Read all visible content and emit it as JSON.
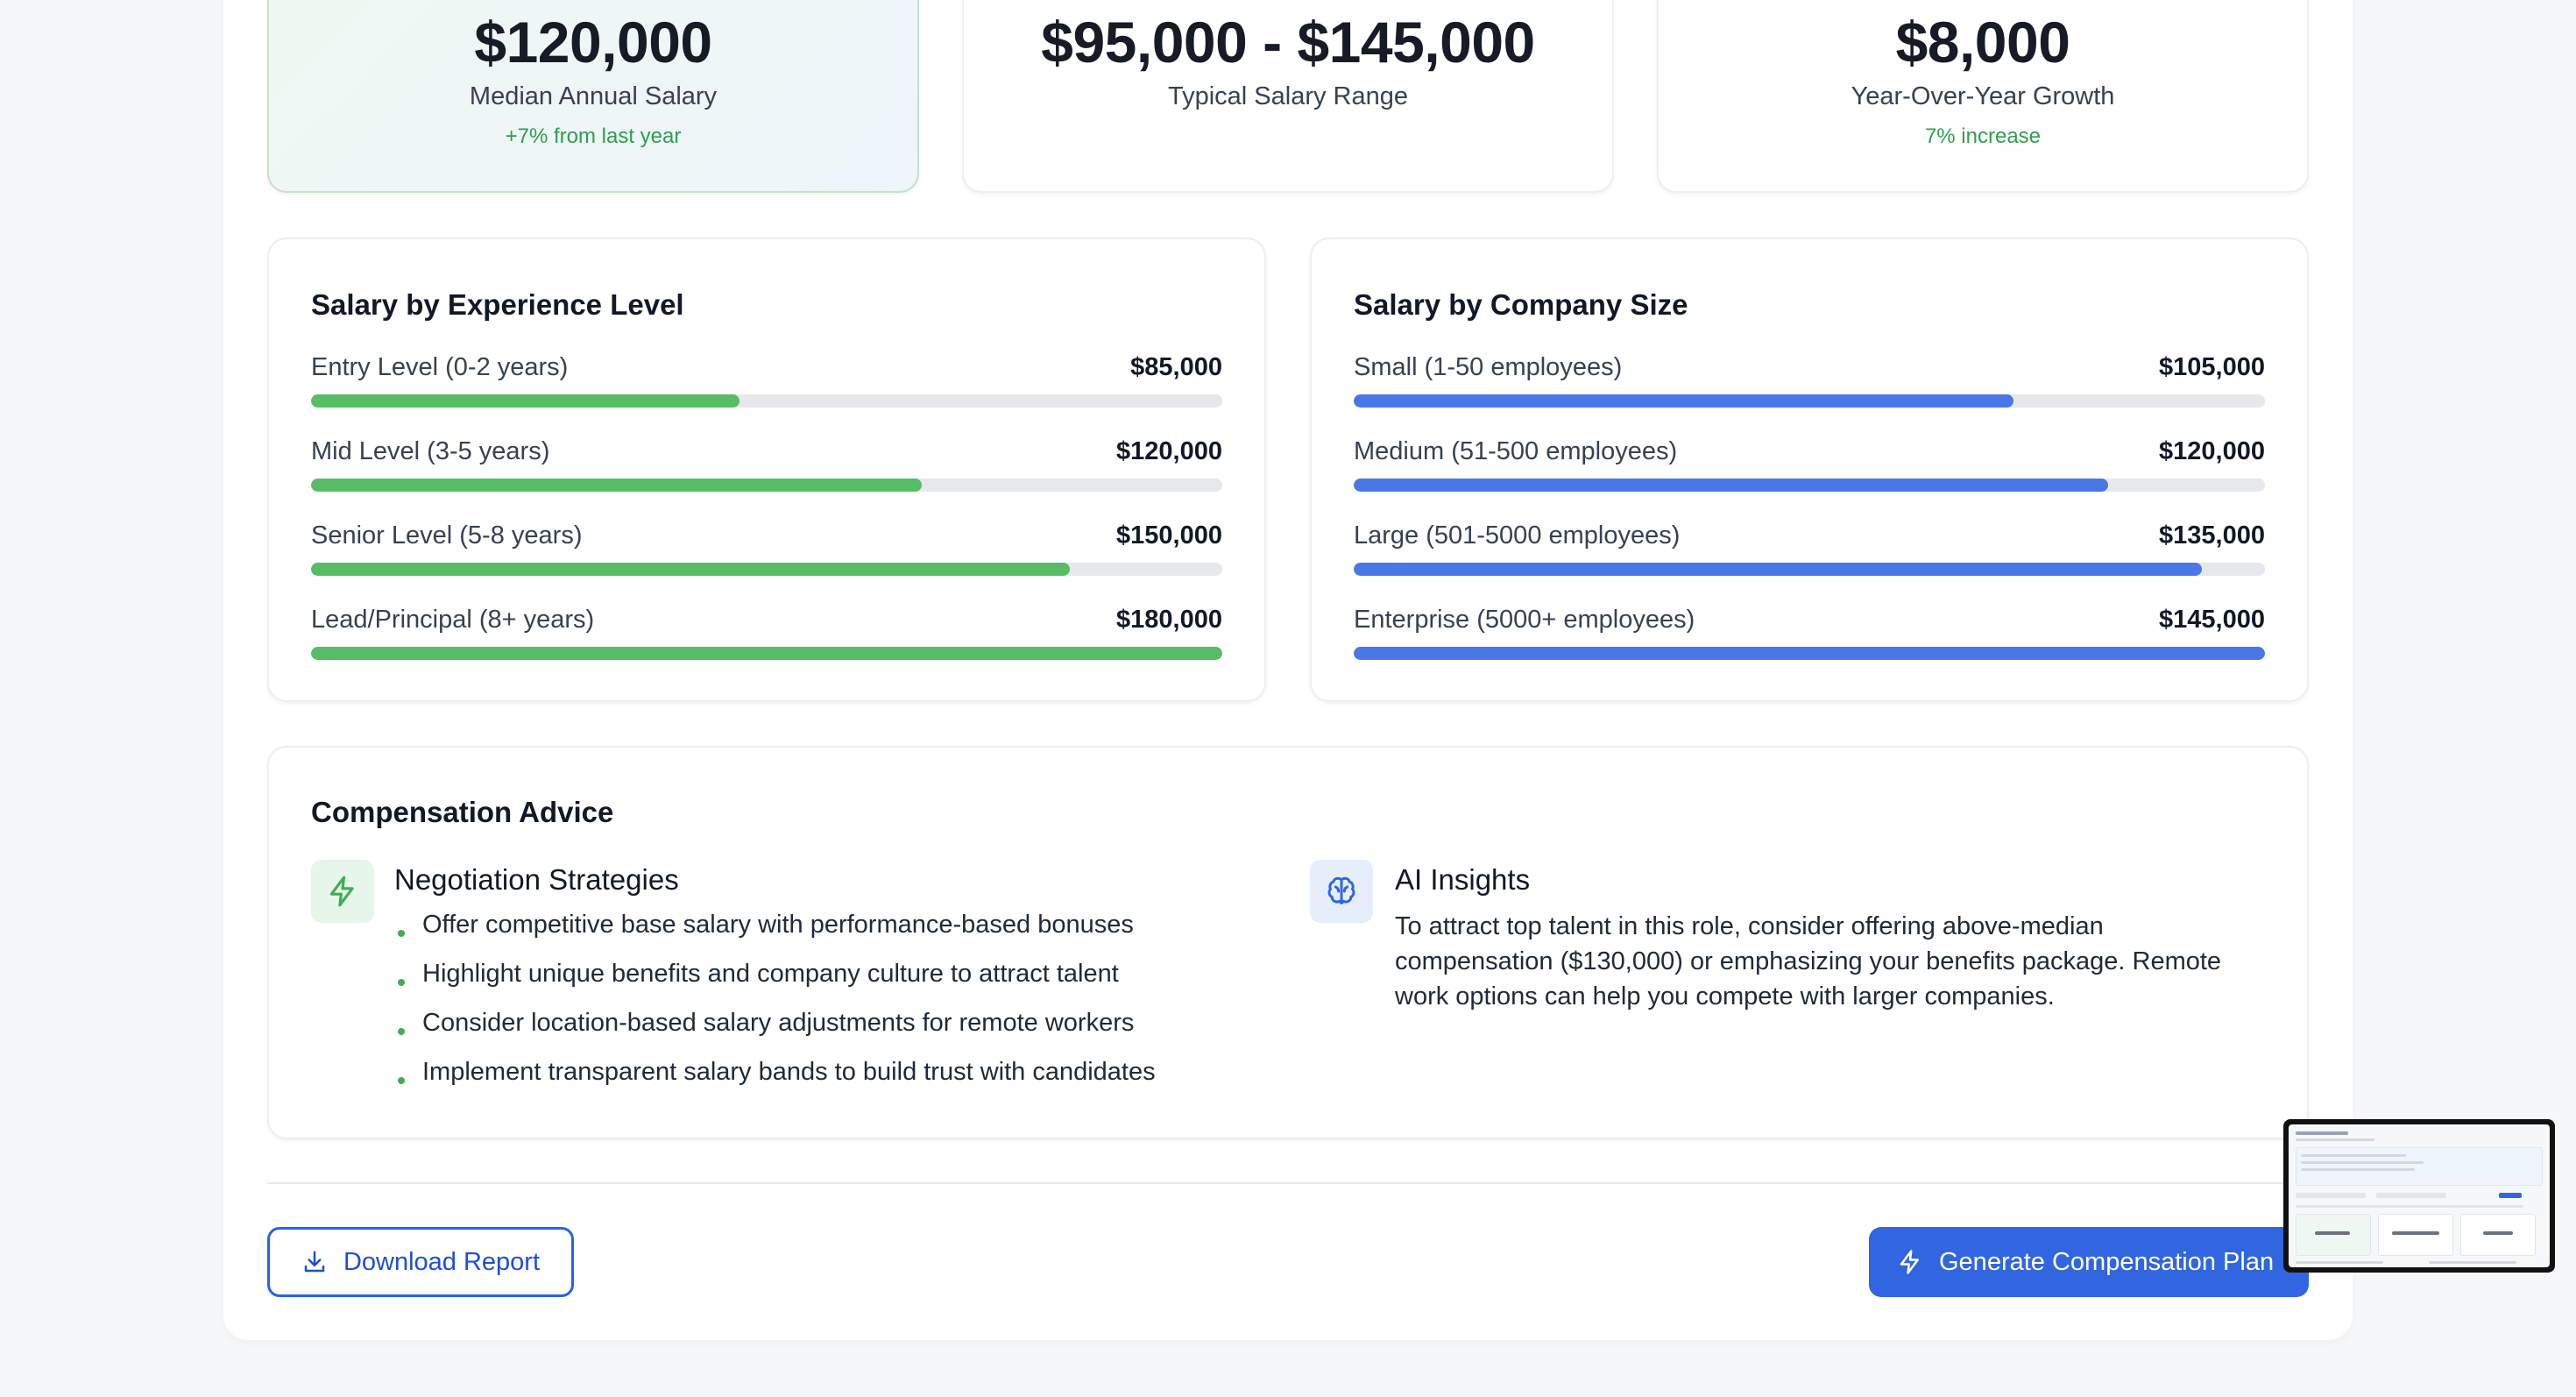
{
  "stats": [
    {
      "value": "$120,000",
      "label": "Median Annual Salary",
      "sub": "+7% from last year"
    },
    {
      "value": "$95,000 - $145,000",
      "label": "Typical Salary Range",
      "sub": ""
    },
    {
      "value": "$8,000",
      "label": "Year-Over-Year Growth",
      "sub": "7% increase"
    }
  ],
  "experience": {
    "title": "Salary by Experience Level",
    "rows": [
      {
        "label": "Entry Level (0-2 years)",
        "value": "$85,000",
        "fill": 0.47
      },
      {
        "label": "Mid Level (3-5 years)",
        "value": "$120,000",
        "fill": 0.67
      },
      {
        "label": "Senior Level (5-8 years)",
        "value": "$150,000",
        "fill": 0.833
      },
      {
        "label": "Lead/Principal (8+ years)",
        "value": "$180,000",
        "fill": 1.0
      }
    ]
  },
  "company_size": {
    "title": "Salary by Company Size",
    "rows": [
      {
        "label": "Small (1-50 employees)",
        "value": "$105,000",
        "fill": 0.724
      },
      {
        "label": "Medium (51-500 employees)",
        "value": "$120,000",
        "fill": 0.828
      },
      {
        "label": "Large (501-5000 employees)",
        "value": "$135,000",
        "fill": 0.931
      },
      {
        "label": "Enterprise (5000+ employees)",
        "value": "$145,000",
        "fill": 1.0
      }
    ]
  },
  "advice": {
    "title": "Compensation Advice",
    "negotiation": {
      "heading": "Negotiation Strategies",
      "icon": "lightning-icon",
      "items": [
        "Offer competitive base salary with performance-based bonuses",
        "Highlight unique benefits and company culture to attract talent",
        "Consider location-based salary adjustments for remote workers",
        "Implement transparent salary bands to build trust with candidates"
      ]
    },
    "ai": {
      "heading": "AI Insights",
      "icon": "brain-icon",
      "lines": [
        "To attract top talent in this role, consider offering above-median",
        "compensation ($130,000) or emphasizing your benefits package. Remote",
        "work options can help you compete with larger companies."
      ]
    }
  },
  "actions": {
    "download_label": "Download Report",
    "generate_label": "Generate Compensation Plan"
  },
  "colors": {
    "accent_green": "#56bd64",
    "accent_blue": "#4a77e6",
    "primary_button": "#3166e0"
  }
}
